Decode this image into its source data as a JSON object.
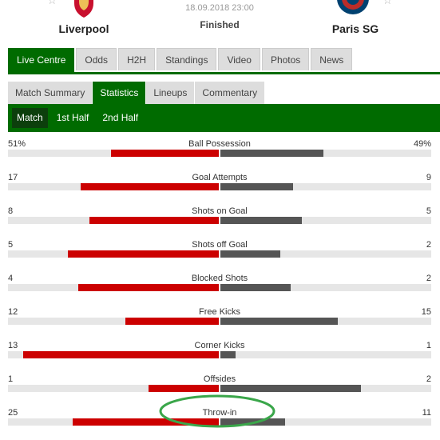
{
  "match": {
    "date": "18.09.2018 23:00",
    "status": "Finished",
    "home": {
      "name": "Liverpool",
      "color": "#c8102e"
    },
    "away": {
      "name": "Paris SG",
      "color": "#004170"
    }
  },
  "main_tabs": [
    "Live Centre",
    "Odds",
    "H2H",
    "Standings",
    "Video",
    "Photos",
    "News"
  ],
  "sub_tabs": [
    "Match Summary",
    "Statistics",
    "Lineups",
    "Commentary"
  ],
  "period_tabs": [
    "Match",
    "1st Half",
    "2nd Half"
  ],
  "colors": {
    "home_bar": "#cc0000",
    "away_bar": "#555555",
    "brand_green": "#006b00",
    "highlight": "#3aa64a"
  },
  "stats": [
    {
      "name": "Ball Possession",
      "home": "51%",
      "away": "49%",
      "home_val": 51,
      "away_val": 49
    },
    {
      "name": "Goal Attempts",
      "home": "17",
      "away": "9",
      "home_val": 17,
      "away_val": 9
    },
    {
      "name": "Shots on Goal",
      "home": "8",
      "away": "5",
      "home_val": 8,
      "away_val": 5
    },
    {
      "name": "Shots off Goal",
      "home": "5",
      "away": "2",
      "home_val": 5,
      "away_val": 2
    },
    {
      "name": "Blocked Shots",
      "home": "4",
      "away": "2",
      "home_val": 4,
      "away_val": 2
    },
    {
      "name": "Free Kicks",
      "home": "12",
      "away": "15",
      "home_val": 12,
      "away_val": 15
    },
    {
      "name": "Corner Kicks",
      "home": "13",
      "away": "1",
      "home_val": 13,
      "away_val": 1
    },
    {
      "name": "Offsides",
      "home": "1",
      "away": "2",
      "home_val": 1,
      "away_val": 2
    },
    {
      "name": "Throw-in",
      "home": "25",
      "away": "11",
      "home_val": 25,
      "away_val": 11
    }
  ]
}
